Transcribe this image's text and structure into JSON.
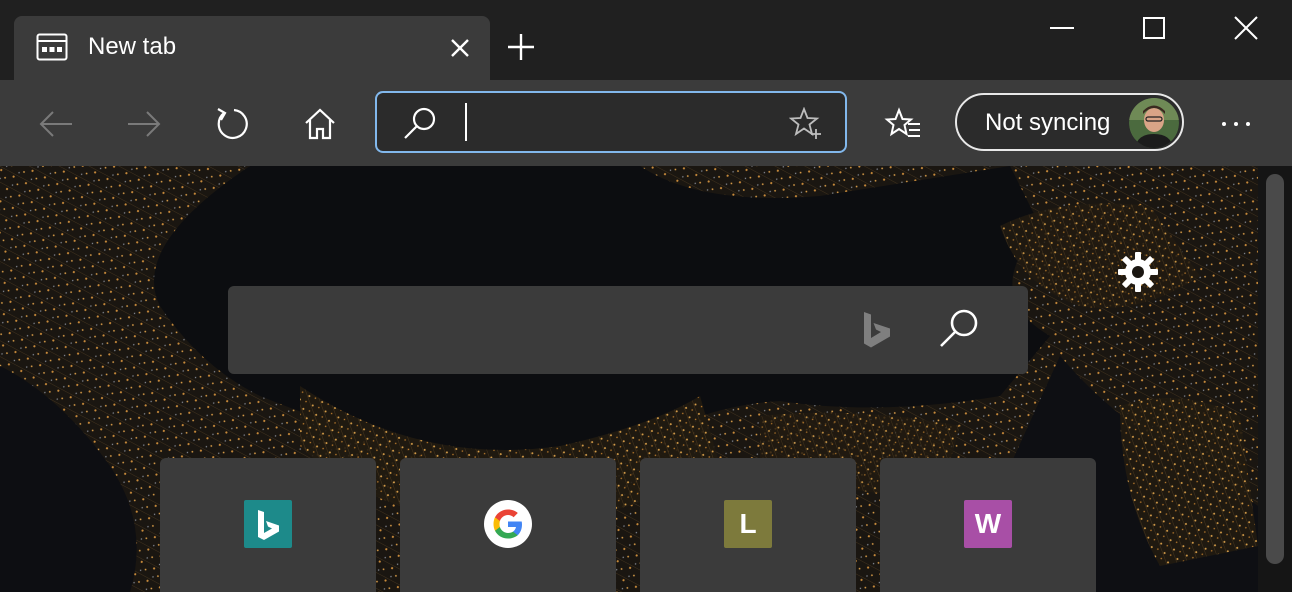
{
  "tab": {
    "title": "New tab",
    "favicon": "new-tab-page-icon"
  },
  "toolbar": {
    "address_value": "",
    "address_placeholder": "",
    "profile_label": "Not syncing",
    "icons": {
      "back": "back-arrow-icon",
      "forward": "forward-arrow-icon",
      "refresh": "refresh-icon",
      "home": "home-icon",
      "favorites": "favorites-icon",
      "more": "more-icon"
    }
  },
  "content": {
    "search_value": "",
    "search_placeholder": "",
    "tiles": [
      {
        "letter": "",
        "label": "",
        "bg": "#1d8a8a",
        "icon": "bing-icon"
      },
      {
        "letter": "",
        "label": "",
        "bg": "#ffffff",
        "icon": "google-icon"
      },
      {
        "letter": "L",
        "label": "",
        "bg": "#7d7a3c",
        "icon": "letter-l-icon"
      },
      {
        "letter": "W",
        "label": "",
        "bg": "#a84fa6",
        "icon": "letter-w-icon"
      }
    ]
  },
  "colors": {
    "address_border": "#82b8ec",
    "toolbar_bg": "#3b3b3b",
    "titlebar_bg": "#202020",
    "bing_tile": "#1d8a8a",
    "letter_l_tile": "#7d7a3c",
    "letter_w_tile": "#a84fa6"
  }
}
